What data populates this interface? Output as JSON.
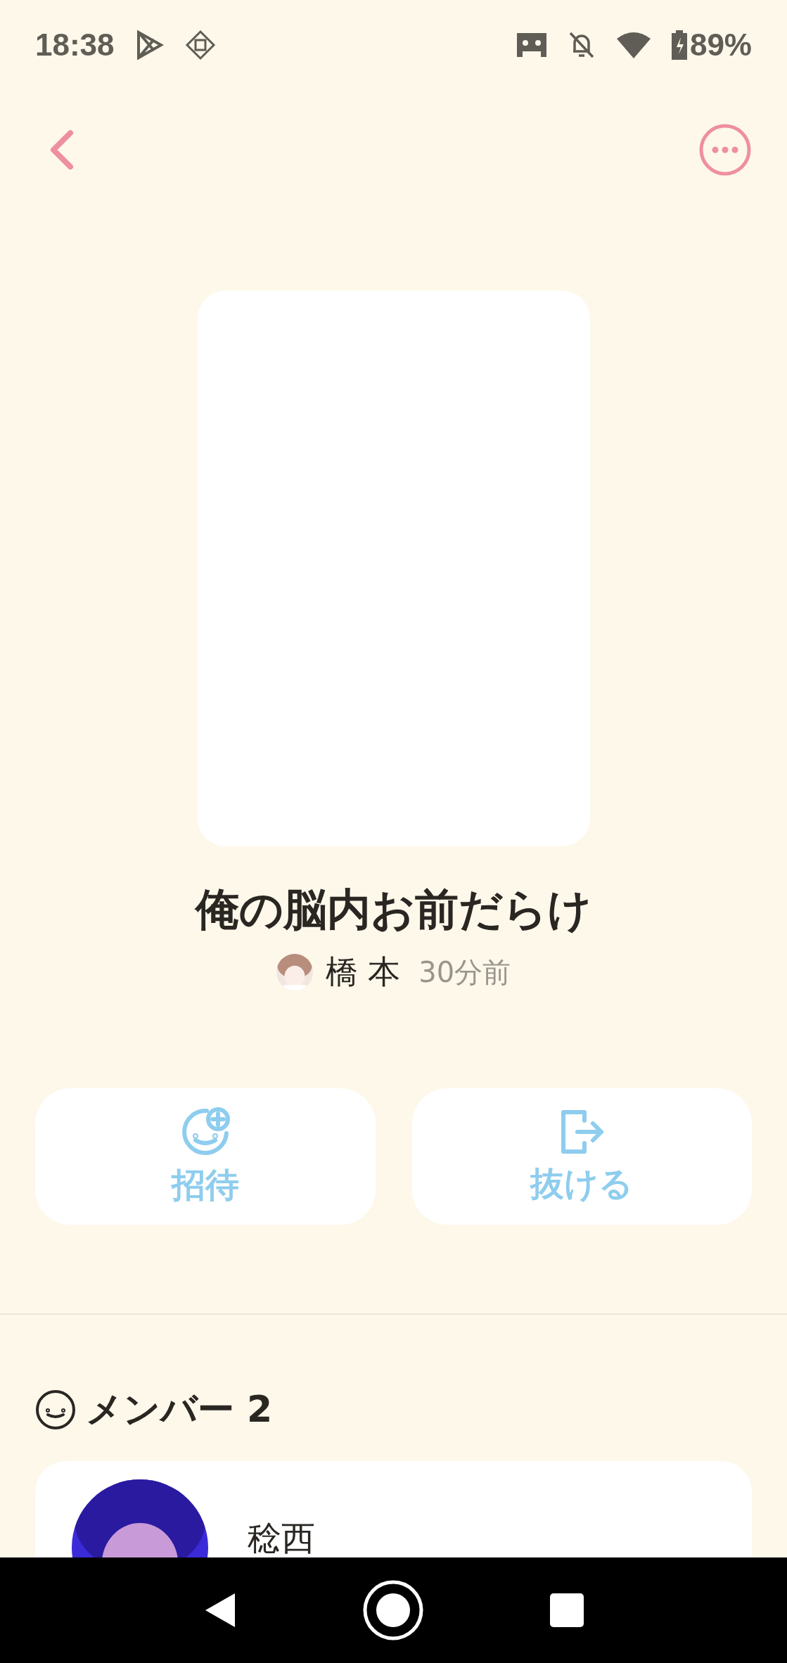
{
  "status_bar": {
    "time": "18:38",
    "battery": "89%"
  },
  "playlist": {
    "title": "俺の脳内お前だらけ",
    "author": {
      "name": "橋 本"
    },
    "time": "30分前"
  },
  "actions": [
    {
      "kind": "invite",
      "label": "招待"
    },
    {
      "kind": "leave",
      "label": "抜ける"
    }
  ],
  "members": {
    "heading": "メンバー 2",
    "items": [
      {
        "name": "稔西"
      }
    ]
  }
}
